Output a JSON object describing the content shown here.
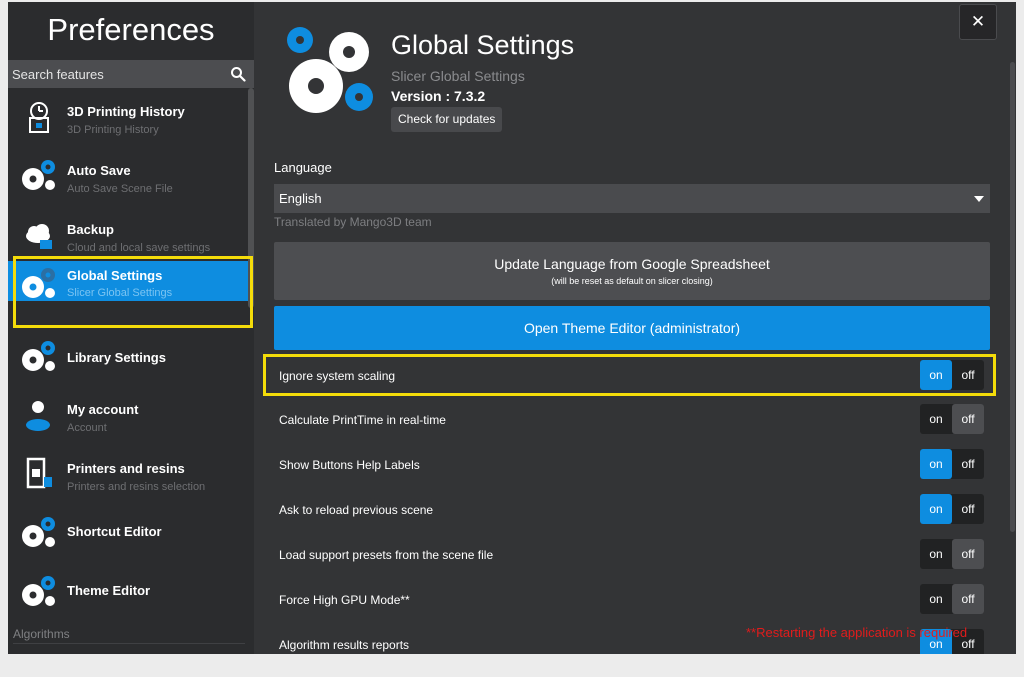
{
  "sidebar": {
    "title": "Preferences",
    "search_placeholder": "Search features",
    "items": [
      {
        "title": "3D Printing History",
        "subtitle": "3D Printing History",
        "icon": "history-icon"
      },
      {
        "title": "Auto Save",
        "subtitle": "Auto Save Scene File",
        "icon": "gears-icon"
      },
      {
        "title": "Backup",
        "subtitle": "Cloud and local save settings",
        "icon": "cloud-icon"
      },
      {
        "title": "Global Settings",
        "subtitle": "Slicer Global Settings",
        "icon": "gears-icon",
        "active": true
      },
      {
        "title": "Library Settings",
        "subtitle": "",
        "icon": "gears-icon"
      },
      {
        "title": "My account",
        "subtitle": "Account",
        "icon": "user-icon"
      },
      {
        "title": "Printers and resins",
        "subtitle": "Printers and resins selection",
        "icon": "printer-icon"
      },
      {
        "title": "Shortcut Editor",
        "subtitle": "",
        "icon": "gears-icon"
      },
      {
        "title": "Theme Editor",
        "subtitle": "",
        "icon": "gears-icon"
      }
    ],
    "section_label": "Algorithms"
  },
  "header": {
    "title": "Global Settings",
    "subtitle": "Slicer Global Settings",
    "version": "Version : 7.3.2",
    "check_updates": "Check for updates",
    "close_glyph": "✕"
  },
  "language": {
    "label": "Language",
    "selected": "English",
    "translated_by": "Translated by Mango3D team"
  },
  "update_button": {
    "label": "Update Language from Google Spreadsheet",
    "note": "(will be reset as default on slicer closing)"
  },
  "theme_button": {
    "label": "Open Theme Editor (administrator)"
  },
  "toggle_labels": {
    "on": "on",
    "off": "off"
  },
  "settings": [
    {
      "label": "Ignore system scaling",
      "value": "on"
    },
    {
      "label": "Calculate PrintTime in real-time",
      "value": "off"
    },
    {
      "label": "Show Buttons Help Labels",
      "value": "on"
    },
    {
      "label": "Ask to reload previous scene",
      "value": "on"
    },
    {
      "label": "Load support presets from the scene file",
      "value": "off"
    },
    {
      "label": "Force High GPU Mode**",
      "value": "off"
    },
    {
      "label": "Algorithm results reports",
      "value": "on"
    }
  ],
  "restart_note": "**Restarting the application is required",
  "colors": {
    "accent": "#0e8de0",
    "highlight": "#f4dc0a",
    "warning": "#e01c1c"
  }
}
